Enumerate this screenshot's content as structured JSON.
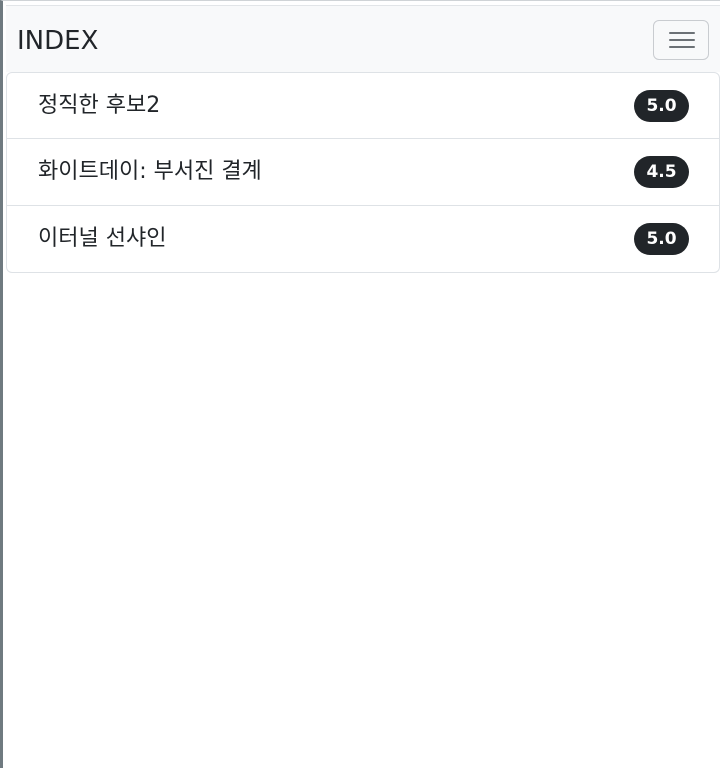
{
  "navbar": {
    "brand": "INDEX",
    "toggler_icon": "hamburger-menu-icon"
  },
  "list": {
    "items": [
      {
        "title": "정직한 후보2",
        "rating": "5.0"
      },
      {
        "title": "화이트데이: 부서진 결계",
        "rating": "4.5"
      },
      {
        "title": "이터널 선샤인",
        "rating": "5.0"
      }
    ]
  },
  "colors": {
    "navbar_bg": "#f8f9fa",
    "badge_bg": "#212529",
    "badge_text": "#ffffff",
    "text": "#212529",
    "border": "#dee2e6"
  }
}
